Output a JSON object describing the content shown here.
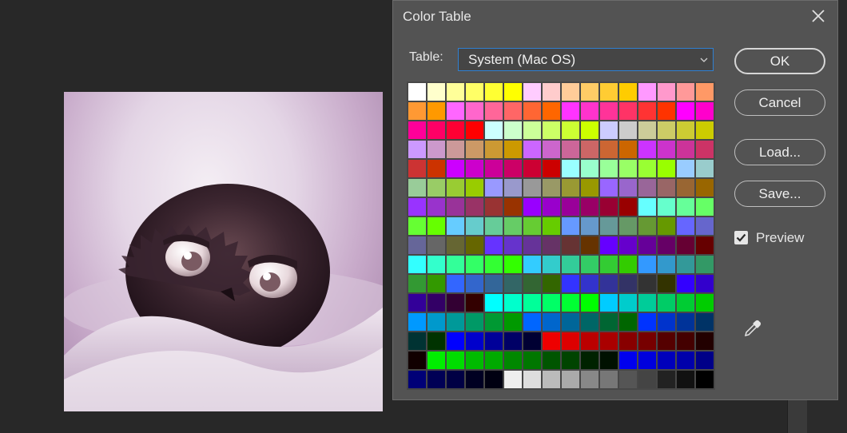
{
  "dialog": {
    "title": "Color Table",
    "table_label": "Table:",
    "table_value": "System (Mac OS)",
    "buttons": {
      "ok": "OK",
      "cancel": "Cancel",
      "load": "Load...",
      "save": "Save..."
    },
    "preview_label": "Preview",
    "preview_checked": true,
    "close_icon": "close-icon",
    "dropdown_icon": "chevron-down-icon",
    "eyedropper_icon": "eyedropper-icon"
  },
  "swatches": [
    [
      "#ffffff",
      "#ffffcc",
      "#ffff99",
      "#ffff66",
      "#ffff33",
      "#ffff00",
      "#ffccff",
      "#ffcccc",
      "#ffcc99",
      "#ffcc66",
      "#ffcc33",
      "#ffcc00",
      "#ff99ff",
      "#ff99cc",
      "#ff9999",
      "#ff9966"
    ],
    [
      "#ff9933",
      "#ff9900",
      "#ff66ff",
      "#ff66cc",
      "#ff6699",
      "#ff6666",
      "#ff6633",
      "#ff6600",
      "#ff33ff",
      "#ff33cc",
      "#ff3399",
      "#ff3366",
      "#ff3333",
      "#ff3300",
      "#ff00ff",
      "#ff00cc"
    ],
    [
      "#ff0099",
      "#ff0066",
      "#ff0033",
      "#ff0000",
      "#ccffff",
      "#ccffcc",
      "#ccff99",
      "#ccff66",
      "#ccff33",
      "#ccff00",
      "#ccccff",
      "#cccccc",
      "#cccc99",
      "#cccc66",
      "#cccc33",
      "#cccc00"
    ],
    [
      "#cc99ff",
      "#cc99cc",
      "#cc9999",
      "#cc9966",
      "#cc9933",
      "#cc9900",
      "#cc66ff",
      "#cc66cc",
      "#cc6699",
      "#cc6666",
      "#cc6633",
      "#cc6600",
      "#cc33ff",
      "#cc33cc",
      "#cc3399",
      "#cc3366"
    ],
    [
      "#cc3333",
      "#cc3300",
      "#cc00ff",
      "#cc00cc",
      "#cc0099",
      "#cc0066",
      "#cc0033",
      "#cc0000",
      "#99ffff",
      "#99ffcc",
      "#99ff99",
      "#99ff66",
      "#99ff33",
      "#99ff00",
      "#99ccff",
      "#99cccc"
    ],
    [
      "#99cc99",
      "#99cc66",
      "#99cc33",
      "#99cc00",
      "#9999ff",
      "#9999cc",
      "#999999",
      "#999966",
      "#999933",
      "#999900",
      "#9966ff",
      "#9966cc",
      "#996699",
      "#996666",
      "#996633",
      "#996600"
    ],
    [
      "#9933ff",
      "#9933cc",
      "#993399",
      "#993366",
      "#993333",
      "#993300",
      "#9900ff",
      "#9900cc",
      "#990099",
      "#990066",
      "#990033",
      "#990000",
      "#66ffff",
      "#66ffcc",
      "#66ff99",
      "#66ff66"
    ],
    [
      "#66ff33",
      "#66ff00",
      "#66ccff",
      "#66cccc",
      "#66cc99",
      "#66cc66",
      "#66cc33",
      "#66cc00",
      "#6699ff",
      "#6699cc",
      "#669999",
      "#669966",
      "#669933",
      "#669900",
      "#6666ff",
      "#6666cc"
    ],
    [
      "#666699",
      "#666666",
      "#666633",
      "#666600",
      "#6633ff",
      "#6633cc",
      "#663399",
      "#663366",
      "#663333",
      "#663300",
      "#6600ff",
      "#6600cc",
      "#660099",
      "#660066",
      "#660033",
      "#660000"
    ],
    [
      "#33ffff",
      "#33ffcc",
      "#33ff99",
      "#33ff66",
      "#33ff33",
      "#33ff00",
      "#33ccff",
      "#33cccc",
      "#33cc99",
      "#33cc66",
      "#33cc33",
      "#33cc00",
      "#3399ff",
      "#3399cc",
      "#339999",
      "#339966"
    ],
    [
      "#339933",
      "#339900",
      "#3366ff",
      "#3366cc",
      "#336699",
      "#336666",
      "#336633",
      "#336600",
      "#3333ff",
      "#3333cc",
      "#333399",
      "#333366",
      "#333333",
      "#333300",
      "#3300ff",
      "#3300cc"
    ],
    [
      "#330099",
      "#330066",
      "#330033",
      "#330000",
      "#00ffff",
      "#00ffcc",
      "#00ff99",
      "#00ff66",
      "#00ff33",
      "#00ff00",
      "#00ccff",
      "#00cccc",
      "#00cc99",
      "#00cc66",
      "#00cc33",
      "#00cc00"
    ],
    [
      "#0099ff",
      "#0099cc",
      "#009999",
      "#009966",
      "#009933",
      "#009900",
      "#0066ff",
      "#0066cc",
      "#006699",
      "#006666",
      "#006633",
      "#006600",
      "#0033ff",
      "#0033cc",
      "#003399",
      "#003366"
    ],
    [
      "#003333",
      "#003300",
      "#0000ff",
      "#0000cc",
      "#000099",
      "#000066",
      "#000033",
      "#ee0000",
      "#dd0000",
      "#bb0000",
      "#aa0000",
      "#880000",
      "#770000",
      "#550000",
      "#440000",
      "#220000"
    ],
    [
      "#110000",
      "#00ee00",
      "#00dd00",
      "#00bb00",
      "#00aa00",
      "#008800",
      "#007700",
      "#005500",
      "#004400",
      "#002200",
      "#001100",
      "#0000ee",
      "#0000dd",
      "#0000bb",
      "#0000aa",
      "#000088"
    ],
    [
      "#000077",
      "#000055",
      "#000044",
      "#000022",
      "#000011",
      "#eeeeee",
      "#dddddd",
      "#bbbbbb",
      "#aaaaaa",
      "#888888",
      "#777777",
      "#555555",
      "#444444",
      "#222222",
      "#111111",
      "#000000"
    ]
  ]
}
